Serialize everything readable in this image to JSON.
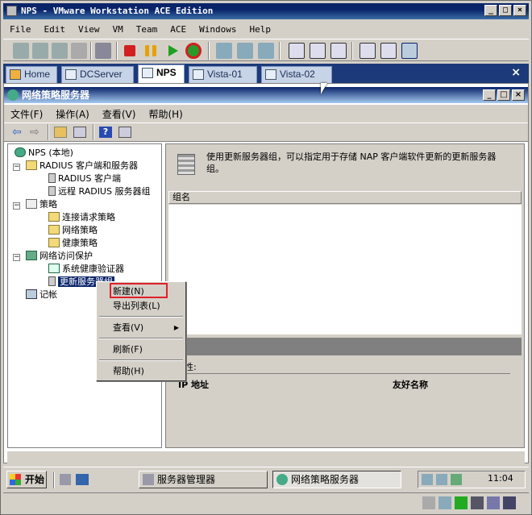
{
  "vmware": {
    "title": "NPS - VMware Workstation ACE Edition",
    "menu": [
      "File",
      "Edit",
      "View",
      "VM",
      "Team",
      "ACE",
      "Windows",
      "Help"
    ],
    "tabs": [
      {
        "label": "Home",
        "active": false
      },
      {
        "label": "DCServer",
        "active": false
      },
      {
        "label": "NPS",
        "active": true
      },
      {
        "label": "Vista-01",
        "active": false
      },
      {
        "label": "Vista-02",
        "active": false
      }
    ]
  },
  "mmc": {
    "title": "网络策略服务器",
    "menu": [
      "文件(F)",
      "操作(A)",
      "查看(V)",
      "帮助(H)"
    ],
    "tree": {
      "root": "NPS (本地)",
      "radius_group": "RADIUS 客户端和服务器",
      "radius_clients": "RADIUS 客户端",
      "remote_radius": "远程 RADIUS 服务器组",
      "policies": "策略",
      "conn_req": "连接请求策略",
      "network_policies": "网络策略",
      "health_policies": "健康策略",
      "nap": "网络访问保护",
      "shv": "系统健康验证器",
      "update_servers": "更新服务器组",
      "accounting": "记帐"
    },
    "description": "使用更新服务器组，可以指定用于存储 NAP 客户端软件更新的更新服务器组。",
    "list_header": "组名",
    "props_label": "性:",
    "col_ip": "IP 地址",
    "col_friendly": "友好名称"
  },
  "context_menu": {
    "new": "新建(N)",
    "export": "导出列表(L)",
    "view": "查看(V)",
    "refresh": "刷新(F)",
    "help": "帮助(H)"
  },
  "taskbar": {
    "start": "开始",
    "server_manager": "服务器管理器",
    "nps": "网络策略服务器",
    "clock": "11:04"
  },
  "colors": {
    "selection": "#0a246a",
    "highlight_box": "#e0202a",
    "tab_bar": "#1c3a7a"
  }
}
